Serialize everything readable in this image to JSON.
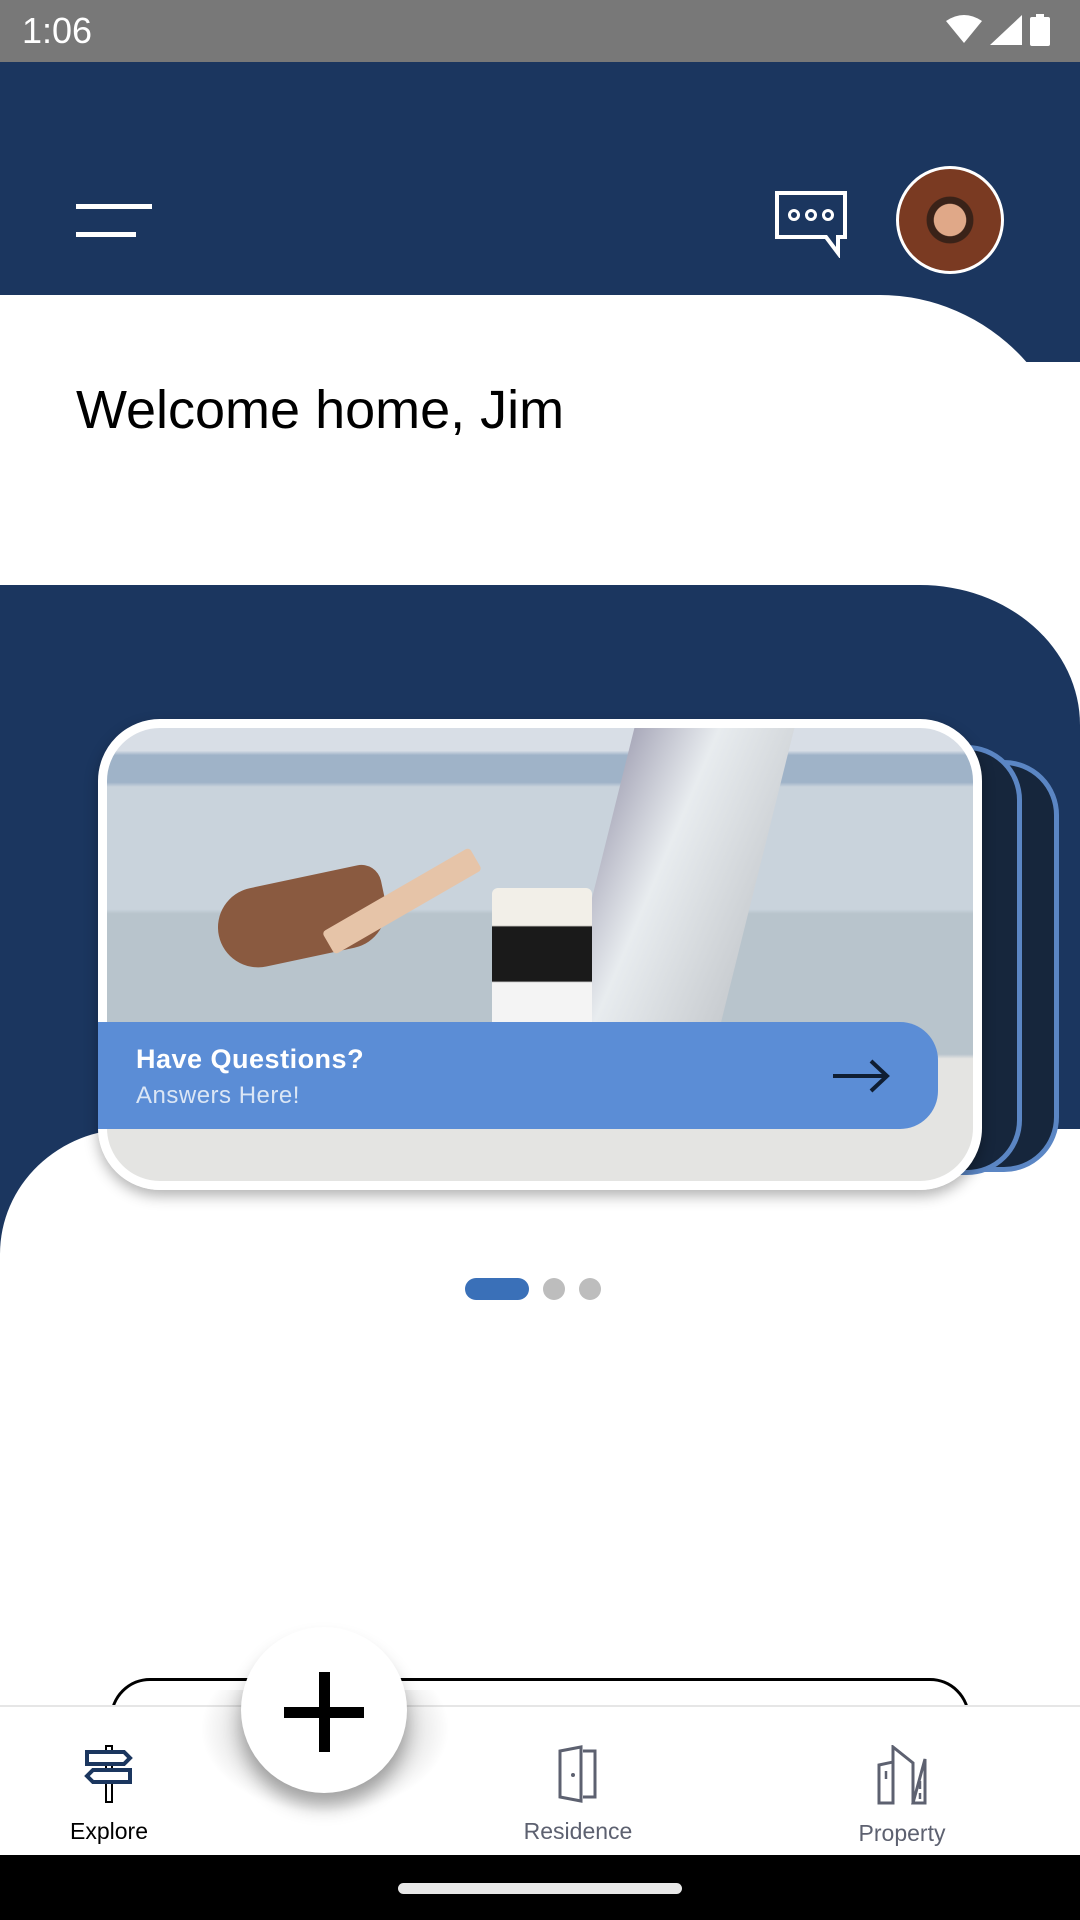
{
  "status_bar": {
    "time": "1:06",
    "icons": [
      "wifi-icon",
      "signal-icon",
      "battery-icon"
    ]
  },
  "header": {
    "menu_icon": "hamburger-icon",
    "chat_icon": "chat-bubble-icon",
    "avatar": "user-avatar"
  },
  "welcome": {
    "title": "Welcome home, Jim"
  },
  "carousel": {
    "slides": [
      {
        "title": "Have Questions?",
        "subtitle": "Answers Here!",
        "action_icon": "arrow-right-icon"
      }
    ],
    "page_count": 3,
    "active_index": 0
  },
  "fab": {
    "icon": "plus-icon"
  },
  "bottom_nav": {
    "items": [
      {
        "label": "Explore",
        "icon": "signpost-icon",
        "active": true
      },
      {
        "label": "Residence",
        "icon": "door-icon",
        "active": false
      },
      {
        "label": "Property",
        "icon": "building-icon",
        "active": false
      }
    ]
  },
  "colors": {
    "navy": "#1b365f",
    "banner": "#5b8dd6",
    "active_dot": "#3a70b8"
  }
}
